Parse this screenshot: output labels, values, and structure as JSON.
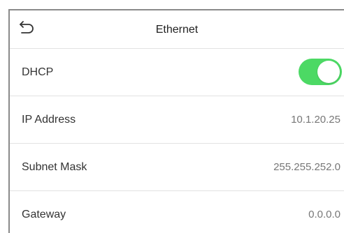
{
  "header": {
    "title": "Ethernet",
    "back_icon": "back-arrow-icon"
  },
  "rows": [
    {
      "label": "DHCP",
      "type": "toggle",
      "enabled": true
    },
    {
      "label": "IP Address",
      "value": "10.1.20.25"
    },
    {
      "label": "Subnet Mask",
      "value": "255.255.252.0"
    },
    {
      "label": "Gateway",
      "value": "0.0.0.0"
    }
  ],
  "colors": {
    "toggle_on": "#4cd964",
    "divider": "#e2e2e2",
    "label_text": "#333333",
    "value_text": "#777777"
  }
}
